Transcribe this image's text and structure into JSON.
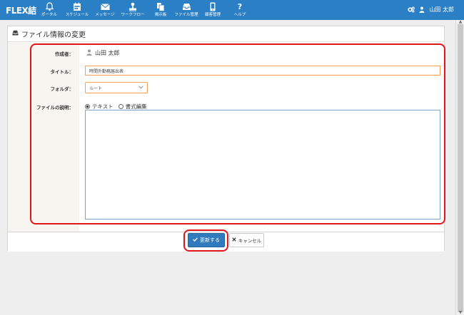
{
  "app": {
    "logo": "FLEX結"
  },
  "nav": [
    {
      "label": "ポータル",
      "icon": "bell-icon"
    },
    {
      "label": "スケジュール",
      "icon": "calendar-icon"
    },
    {
      "label": "メッセージ",
      "icon": "envelope-icon"
    },
    {
      "label": "ワークフロー",
      "icon": "stamp-icon"
    },
    {
      "label": "掲示板",
      "icon": "board-icon"
    },
    {
      "label": "ファイル管理",
      "icon": "inbox-icon"
    },
    {
      "label": "顧客管理",
      "icon": "phone-icon"
    },
    {
      "label": "ヘルプ",
      "icon": "question-icon"
    }
  ],
  "user": {
    "name": "山田 太郎"
  },
  "page": {
    "title": "ファイル情報の変更"
  },
  "form": {
    "creator_label": "作成者：",
    "creator_value": "山田 太郎",
    "title_label": "タイトル：",
    "title_value": "時間外勤務届出表",
    "folder_label": "フォルダ：",
    "folder_value": "ルート",
    "description_label": "ファイルの説明：",
    "mode_text": "テキスト",
    "mode_rich": "書式編集",
    "mode_selected": "テキスト",
    "description_value": ""
  },
  "buttons": {
    "update": "更新する",
    "cancel": "キャンセル"
  },
  "colors": {
    "header_bg": "#2b7fc4",
    "primary_button": "#2f7bbd",
    "annotation": "#e0161b",
    "input_border": "#f0a052"
  }
}
